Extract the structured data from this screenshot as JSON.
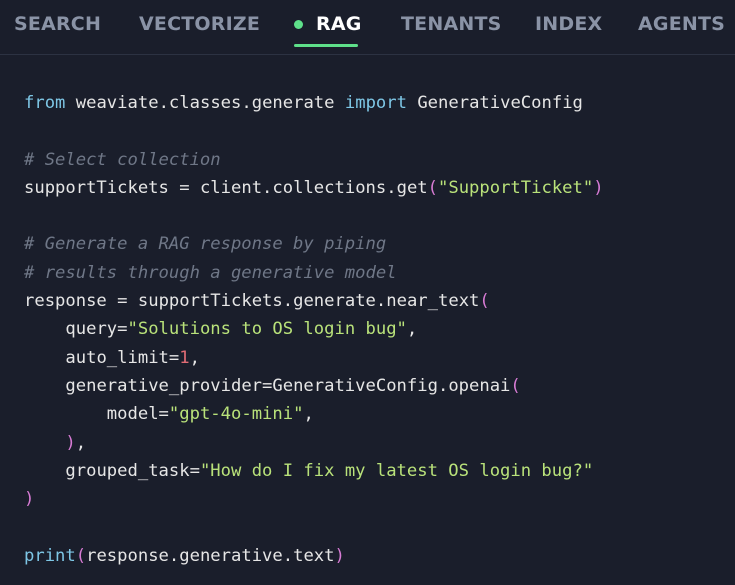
{
  "tabs": [
    {
      "label": "SEARCH",
      "active": false
    },
    {
      "label": "VECTORIZE",
      "active": false
    },
    {
      "label": "RAG",
      "active": true
    },
    {
      "label": "TENANTS",
      "active": false
    },
    {
      "label": "INDEX",
      "active": false
    },
    {
      "label": "AGENTS",
      "active": false
    }
  ],
  "colors": {
    "background": "#1a1e2b",
    "active_accent": "#5ee08a",
    "inactive_tab": "#8a93a6",
    "keyword": "#7ec7e6",
    "string": "#b9e27a",
    "comment": "#6f7787",
    "number": "#e06c75",
    "bracket": "#d77bd4"
  },
  "code": {
    "language": "python",
    "lines": [
      "from weaviate.classes.generate import GenerativeConfig",
      "",
      "# Select collection",
      "supportTickets = client.collections.get(\"SupportTicket\")",
      "",
      "# Generate a RAG response by piping",
      "# results through a generative model",
      "response = supportTickets.generate.near_text(",
      "    query=\"Solutions to OS login bug\",",
      "    auto_limit=1,",
      "    generative_provider=GenerativeConfig.openai(",
      "        model=\"gpt-4o-mini\",",
      "    ),",
      "    grouped_task=\"How do I fix my latest OS login bug?\"",
      ")",
      "",
      "print(response.generative.text)"
    ]
  }
}
